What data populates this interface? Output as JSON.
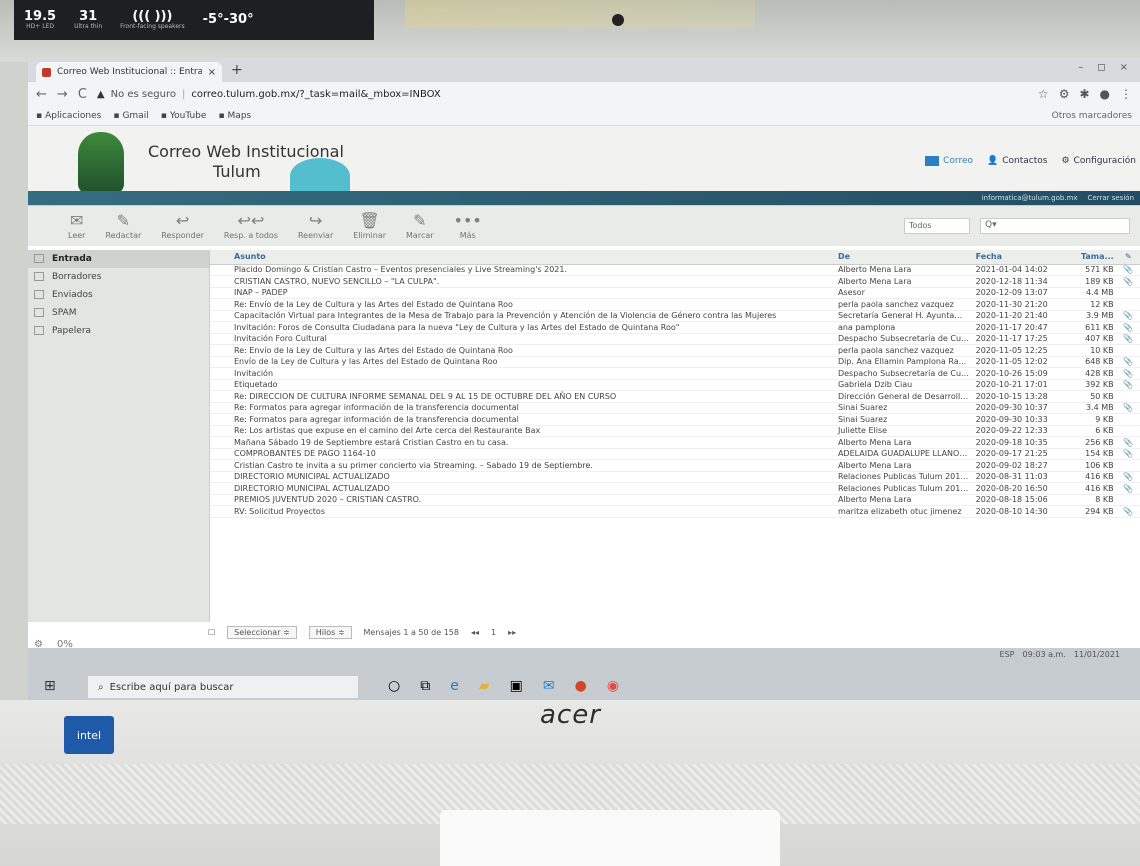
{
  "monitor": {
    "specs": [
      {
        "big": "19.5",
        "small": "HD+ LED"
      },
      {
        "big": "31",
        "small": "Ultra thin"
      },
      {
        "big": "((( )))",
        "small": "Front-facing speakers"
      },
      {
        "big": "-5°-30°",
        "small": ""
      }
    ],
    "brand": "acer",
    "badge": "intel"
  },
  "browser": {
    "tab_title": "Correo Web Institucional :: Entrada",
    "tab_close": "×",
    "new_tab": "+",
    "insecure_label": "No es seguro",
    "url": "correo.tulum.gob.mx/?_task=mail&_mbox=INBOX",
    "bookmarks": [
      {
        "label": "Aplicaciones",
        "icon": "apps-icon"
      },
      {
        "label": "Gmail",
        "icon": "google-icon"
      },
      {
        "label": "YouTube",
        "icon": "youtube-icon"
      },
      {
        "label": "Maps",
        "icon": "maps-icon"
      }
    ],
    "other_bookmarks": "Otros marcadores"
  },
  "app": {
    "title_line1": "Correo Web Institucional",
    "title_line2": "Tulum",
    "nav": {
      "mail": "Correo",
      "contacts": "Contactos",
      "settings": "Configuración"
    },
    "user_email": "informatica@tulum.gob.mx",
    "logout": "Cerrar sesión"
  },
  "toolbar": {
    "buttons": [
      "Leer",
      "Redactar",
      "Responder",
      "Resp. a todos",
      "Reenviar",
      "Eliminar",
      "Marcar",
      "Más"
    ],
    "filter": "Todos",
    "search_placeholder": "Q▾"
  },
  "folders": [
    {
      "label": "Entrada",
      "active": true
    },
    {
      "label": "Borradores",
      "active": false
    },
    {
      "label": "Enviados",
      "active": false
    },
    {
      "label": "SPAM",
      "active": false
    },
    {
      "label": "Papelera",
      "active": false
    }
  ],
  "folder_footer": {
    "gear": "⚙",
    "quota": "0%"
  },
  "columns": {
    "subject": "Asunto",
    "from": "De",
    "date": "Fecha",
    "size": "Tama..."
  },
  "messages": [
    {
      "subject": "Placido Domingo & Cristian Castro – Eventos presenciales y Live Streaming's 2021.",
      "from": "Alberto Mena Lara",
      "date": "2021-01-04 14:02",
      "size": "571 KB",
      "att": true
    },
    {
      "subject": "CRISTIAN CASTRO, NUEVO SENCILLO – \"LA CULPA\".",
      "from": "Alberto Mena Lara",
      "date": "2020-12-18 11:34",
      "size": "189 KB",
      "att": true
    },
    {
      "subject": "INAP – PADEP",
      "from": "Asesor",
      "date": "2020-12-09 13:07",
      "size": "4.4 MB",
      "att": false
    },
    {
      "subject": "Re: Envío de la Ley de Cultura y las Artes del Estado de Quintana Roo",
      "from": "perla paola sanchez vazquez",
      "date": "2020-11-30 21:20",
      "size": "12 KB",
      "att": false
    },
    {
      "subject": "Capacitación Virtual para Integrantes de la Mesa de Trabajo para la Prevención y Atención de la Violencia de Género contra las Mujeres",
      "from": "Secretaría General H. Ayuntami...",
      "date": "2020-11-20 21:40",
      "size": "3.9 MB",
      "att": true
    },
    {
      "subject": "Invitación: Foros de Consulta Ciudadana para la nueva \"Ley de Cultura y las Artes del Estado de Quintana Roo\"",
      "from": "ana pamplona",
      "date": "2020-11-17 20:47",
      "size": "611 KB",
      "att": true
    },
    {
      "subject": "Invitación Foro Cultural",
      "from": "Despacho Subsecretaría de Cult...",
      "date": "2020-11-17 17:25",
      "size": "407 KB",
      "att": true
    },
    {
      "subject": "Re: Envío de la Ley de Cultura y las Artes del Estado de Quintana Roo",
      "from": "perla paola sanchez vazquez",
      "date": "2020-11-05 12:25",
      "size": "10 KB",
      "att": false
    },
    {
      "subject": "Envío de la Ley de Cultura y las Artes del Estado de Quintana Roo",
      "from": "Dip. Ana Ellamin Pamplona Ra...",
      "date": "2020-11-05 12:02",
      "size": "648 KB",
      "att": true
    },
    {
      "subject": "Invitación",
      "from": "Despacho Subsecretaría de Cult...",
      "date": "2020-10-26 15:09",
      "size": "428 KB",
      "att": true
    },
    {
      "subject": "Etiquetado",
      "from": "Gabriela Dzib Ciau",
      "date": "2020-10-21 17:01",
      "size": "392 KB",
      "att": true
    },
    {
      "subject": "Re: DIRECCION DE CULTURA INFORME SEMANAL DEL 9 AL 15 DE OCTUBRE DEL AÑO EN CURSO",
      "from": "Dirección General de Desarrollo...",
      "date": "2020-10-15 13:28",
      "size": "50 KB",
      "att": false
    },
    {
      "subject": "Re: Formatos para agregar información de la transferencia documental",
      "from": "Sinai Suarez",
      "date": "2020-09-30 10:37",
      "size": "3.4 MB",
      "att": true
    },
    {
      "subject": "Re: Formatos para agregar información de la transferencia documental",
      "from": "Sinai Suarez",
      "date": "2020-09-30 10:33",
      "size": "9 KB",
      "att": false
    },
    {
      "subject": "Re: Los artistas que expuse en el camino del Arte cerca del Restaurante Bax",
      "from": "Juliette Elise",
      "date": "2020-09-22 12:33",
      "size": "6 KB",
      "att": false
    },
    {
      "subject": "Mañana Sábado 19 de Septiembre estará Cristian Castro en tu casa.",
      "from": "Alberto Mena Lara",
      "date": "2020-09-18 10:35",
      "size": "256 KB",
      "att": true
    },
    {
      "subject": "COMPROBANTES DE PAGO 1164-10",
      "from": "ADELAIDA GUADALUPE LLANOS...",
      "date": "2020-09-17 21:25",
      "size": "154 KB",
      "att": true
    },
    {
      "subject": "Cristian Castro te invita a su primer concierto via Streaming. – Sabado 19 de Septiembre.",
      "from": "Alberto Mena Lara",
      "date": "2020-09-02 18:27",
      "size": "106 KB",
      "att": false
    },
    {
      "subject": "DIRECTORIO MUNICIPAL ACTUALIZADO",
      "from": "Relaciones Publicas Tulum 2018...",
      "date": "2020-08-31 11:03",
      "size": "416 KB",
      "att": true
    },
    {
      "subject": "DIRECTORIO MUNICIPAL ACTUALIZADO",
      "from": "Relaciones Publicas Tulum 2018...",
      "date": "2020-08-20 16:50",
      "size": "416 KB",
      "att": true
    },
    {
      "subject": "PREMIOS JUVENTUD 2020 – CRISTIAN CASTRO.",
      "from": "Alberto Mena Lara",
      "date": "2020-08-18 15:06",
      "size": "8 KB",
      "att": false
    },
    {
      "subject": "RV: Solicitud Proyectos",
      "from": "maritza elizabeth otuc jimenez",
      "date": "2020-08-10 14:30",
      "size": "294 KB",
      "att": true
    }
  ],
  "pager": {
    "select": "Seleccionar ≑",
    "threads": "Hilos ≑",
    "count": "Mensajes 1 a 50 de 158",
    "page": "1"
  },
  "taskbar": {
    "search": "Escribe aquí para buscar",
    "time": "09:03 a.m.",
    "date": "11/01/2021",
    "lang": "ESP"
  }
}
